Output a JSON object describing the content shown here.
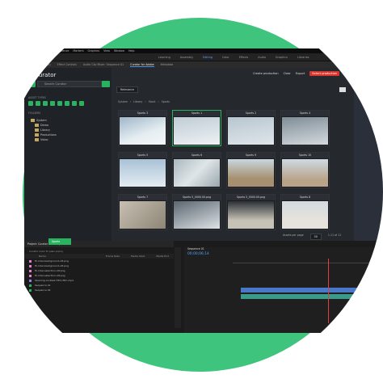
{
  "menu": [
    "File",
    "Edit",
    "Clip",
    "Sequence",
    "Markers",
    "Graphics",
    "View",
    "Window",
    "Help"
  ],
  "workspaces": [
    "Learning",
    "Assembly",
    "Editing",
    "Color",
    "Effects",
    "Audio",
    "Graphics",
    "Libraries"
  ],
  "active_workspace": "Editing",
  "panel_tabs": [
    "Source: (no clips)",
    "Effect Controls",
    "Audio Clip Mixer: Sequence 01",
    "Curator for Adobe",
    "Metadata"
  ],
  "active_panel_tab": "Curator for Adobe",
  "curator": {
    "logo_text": "curator",
    "search_placeholder": "Search Curator",
    "asset_types_label": "ASSET TYPES",
    "folders_label": "FOLDERS",
    "folders": [
      "System",
      "Demo",
      "Library",
      "Productions",
      "Video"
    ],
    "toolbar": {
      "create_production": "Create production",
      "clear": "Clear",
      "export": "Export",
      "select_production": "Select production"
    },
    "sort_label": "Relevance",
    "breadcrumb": [
      "System",
      "Library",
      "Stock",
      "Sports"
    ],
    "cards": [
      "Sports 3",
      "Sports 1",
      "Sports 2",
      "Sports 4",
      "Sports 5",
      "Sports 6",
      "Sports 9",
      "Sports 10",
      "Sports 7",
      "Sports 5_0000.00.png",
      "Sports 5_0000.00.png",
      "Sports 8"
    ],
    "assets_per_page_label": "Assets per page",
    "assets_per_page": "50",
    "range_text": "1-11 of 11"
  },
  "bottom": {
    "green_tab": "Sports",
    "project_tab": "Project: Curator main To plein",
    "project_path": "Curator main To plein.prproj",
    "columns": [
      "Name",
      "Frame Rate",
      "Media Start",
      "Media End"
    ],
    "items": [
      "Hi-rider-background-ott.png",
      "Hi-rider-background-ott.png",
      "Hi-rider-selection-ott.png",
      "Hi-rider-selection-ott.png",
      "Opening-curated-Hitm-film.mp4",
      "Sequence 01",
      "Sequence 02"
    ],
    "timecode": "00;00;06;14",
    "sequence_tab": "Sequence 01"
  },
  "colors": {
    "brand_green": "#29b35f",
    "accent_blue": "#4ea3ff",
    "alert_red": "#d9342b",
    "ring_green": "#3ec47c"
  }
}
